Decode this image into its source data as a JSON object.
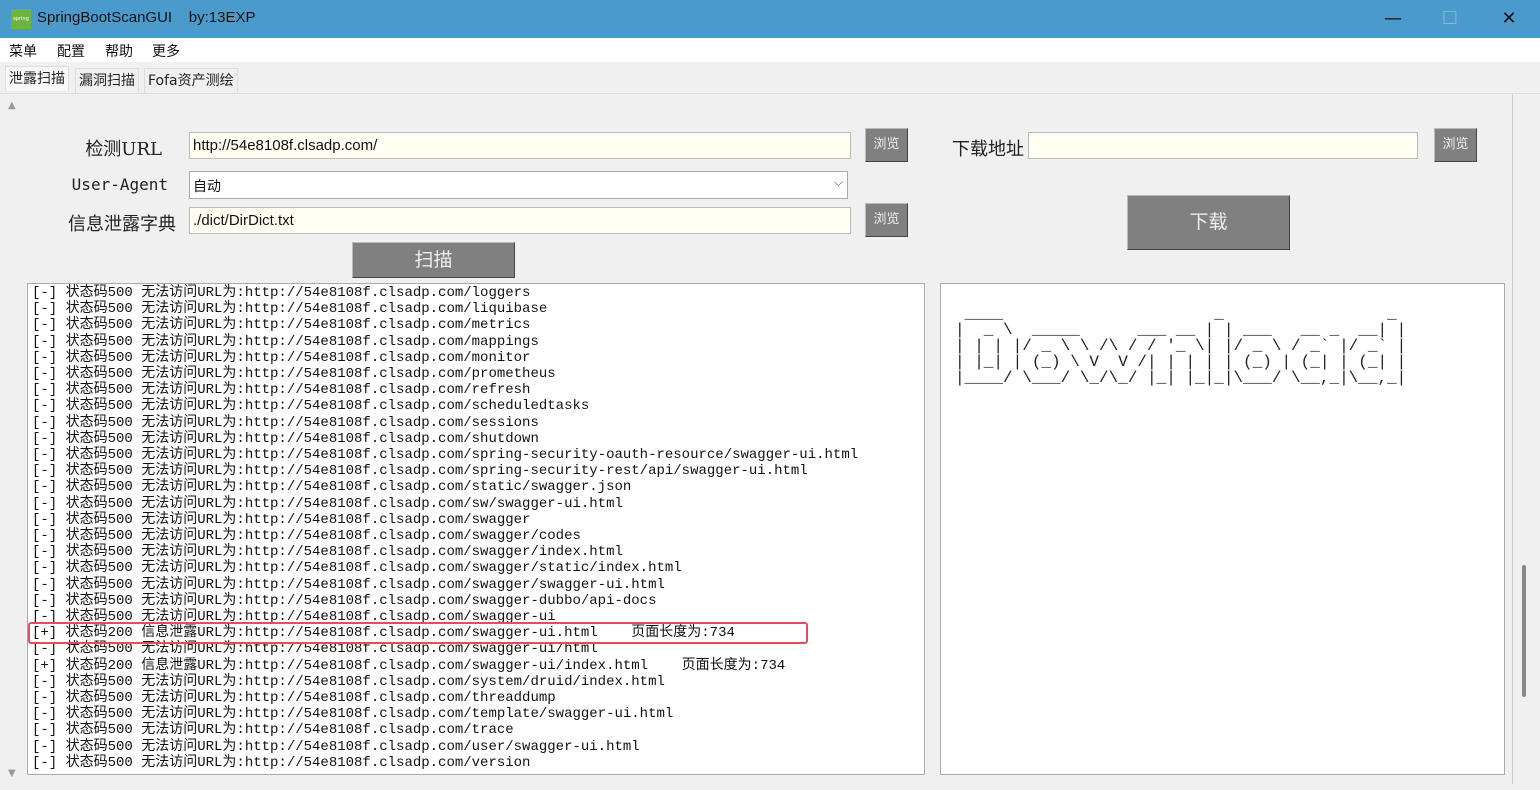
{
  "window": {
    "app_name": "SpringBootScanGUI",
    "title": "SpringBootScanGUI    by:13EXP",
    "icon_text": "spring",
    "icons": [
      "minimize-icon",
      "maximize-icon",
      "close-icon"
    ]
  },
  "menu": [
    "菜单",
    "配置",
    "帮助",
    "更多"
  ],
  "tabs": [
    {
      "label": "泄露扫描",
      "active": true
    },
    {
      "label": "漏洞扫描"
    },
    {
      "label": "Fofa资产测绘"
    }
  ],
  "form": {
    "url_label": "检测URL",
    "url_value": "http://54e8108f.clsadp.com/",
    "ua_label": "User-Agent",
    "ua_value": "自动",
    "dict_label": "信息泄露字典",
    "dict_value": "./dict/DirDict.txt",
    "browse_label": "浏览",
    "scan_label": "扫描"
  },
  "download": {
    "path_label": "下载地址",
    "path_value": "",
    "browse_label": "浏览",
    "button_label": "下载",
    "ascii_logo": " ____                      _                 _ \n|  _ \\  _____      ___ __ | | ___   __ _  __| |\n| | | |/ _ \\ \\ /\\ / / '_ \\| |/ _ \\ / _` |/ _` |\n| |_| | (_) \\ V  V /| | | | | (_) | (_| | (_| |\n|____/ \\___/ \\_/\\_/ |_| |_|_|\\___/ \\__,_|\\__,_|"
  },
  "log": [
    "[-] 状态码500 无法访问URL为:http://54e8108f.clsadp.com/loggers",
    "[-] 状态码500 无法访问URL为:http://54e8108f.clsadp.com/liquibase",
    "[-] 状态码500 无法访问URL为:http://54e8108f.clsadp.com/metrics",
    "[-] 状态码500 无法访问URL为:http://54e8108f.clsadp.com/mappings",
    "[-] 状态码500 无法访问URL为:http://54e8108f.clsadp.com/monitor",
    "[-] 状态码500 无法访问URL为:http://54e8108f.clsadp.com/prometheus",
    "[-] 状态码500 无法访问URL为:http://54e8108f.clsadp.com/refresh",
    "[-] 状态码500 无法访问URL为:http://54e8108f.clsadp.com/scheduledtasks",
    "[-] 状态码500 无法访问URL为:http://54e8108f.clsadp.com/sessions",
    "[-] 状态码500 无法访问URL为:http://54e8108f.clsadp.com/shutdown",
    "[-] 状态码500 无法访问URL为:http://54e8108f.clsadp.com/spring-security-oauth-resource/swagger-ui.html",
    "[-] 状态码500 无法访问URL为:http://54e8108f.clsadp.com/spring-security-rest/api/swagger-ui.html",
    "[-] 状态码500 无法访问URL为:http://54e8108f.clsadp.com/static/swagger.json",
    "[-] 状态码500 无法访问URL为:http://54e8108f.clsadp.com/sw/swagger-ui.html",
    "[-] 状态码500 无法访问URL为:http://54e8108f.clsadp.com/swagger",
    "[-] 状态码500 无法访问URL为:http://54e8108f.clsadp.com/swagger/codes",
    "[-] 状态码500 无法访问URL为:http://54e8108f.clsadp.com/swagger/index.html",
    "[-] 状态码500 无法访问URL为:http://54e8108f.clsadp.com/swagger/static/index.html",
    "[-] 状态码500 无法访问URL为:http://54e8108f.clsadp.com/swagger/swagger-ui.html",
    "[-] 状态码500 无法访问URL为:http://54e8108f.clsadp.com/swagger-dubbo/api-docs",
    "[-] 状态码500 无法访问URL为:http://54e8108f.clsadp.com/swagger-ui",
    "[+] 状态码200 信息泄露URL为:http://54e8108f.clsadp.com/swagger-ui.html    页面长度为:734",
    "[-] 状态码500 无法访问URL为:http://54e8108f.clsadp.com/swagger-ui/html",
    "[+] 状态码200 信息泄露URL为:http://54e8108f.clsadp.com/swagger-ui/index.html    页面长度为:734",
    "[-] 状态码500 无法访问URL为:http://54e8108f.clsadp.com/system/druid/index.html",
    "[-] 状态码500 无法访问URL为:http://54e8108f.clsadp.com/threaddump",
    "[-] 状态码500 无法访问URL为:http://54e8108f.clsadp.com/template/swagger-ui.html",
    "[-] 状态码500 无法访问URL为:http://54e8108f.clsadp.com/trace",
    "[-] 状态码500 无法访问URL为:http://54e8108f.clsadp.com/user/swagger-ui.html",
    "[-] 状态码500 无法访问URL为:http://54e8108f.clsadp.com/version"
  ],
  "colors": {
    "titlebar": "#4a9acb",
    "highlight": "#e0505a",
    "button": "#808080",
    "input_bg": "#fffff2"
  }
}
